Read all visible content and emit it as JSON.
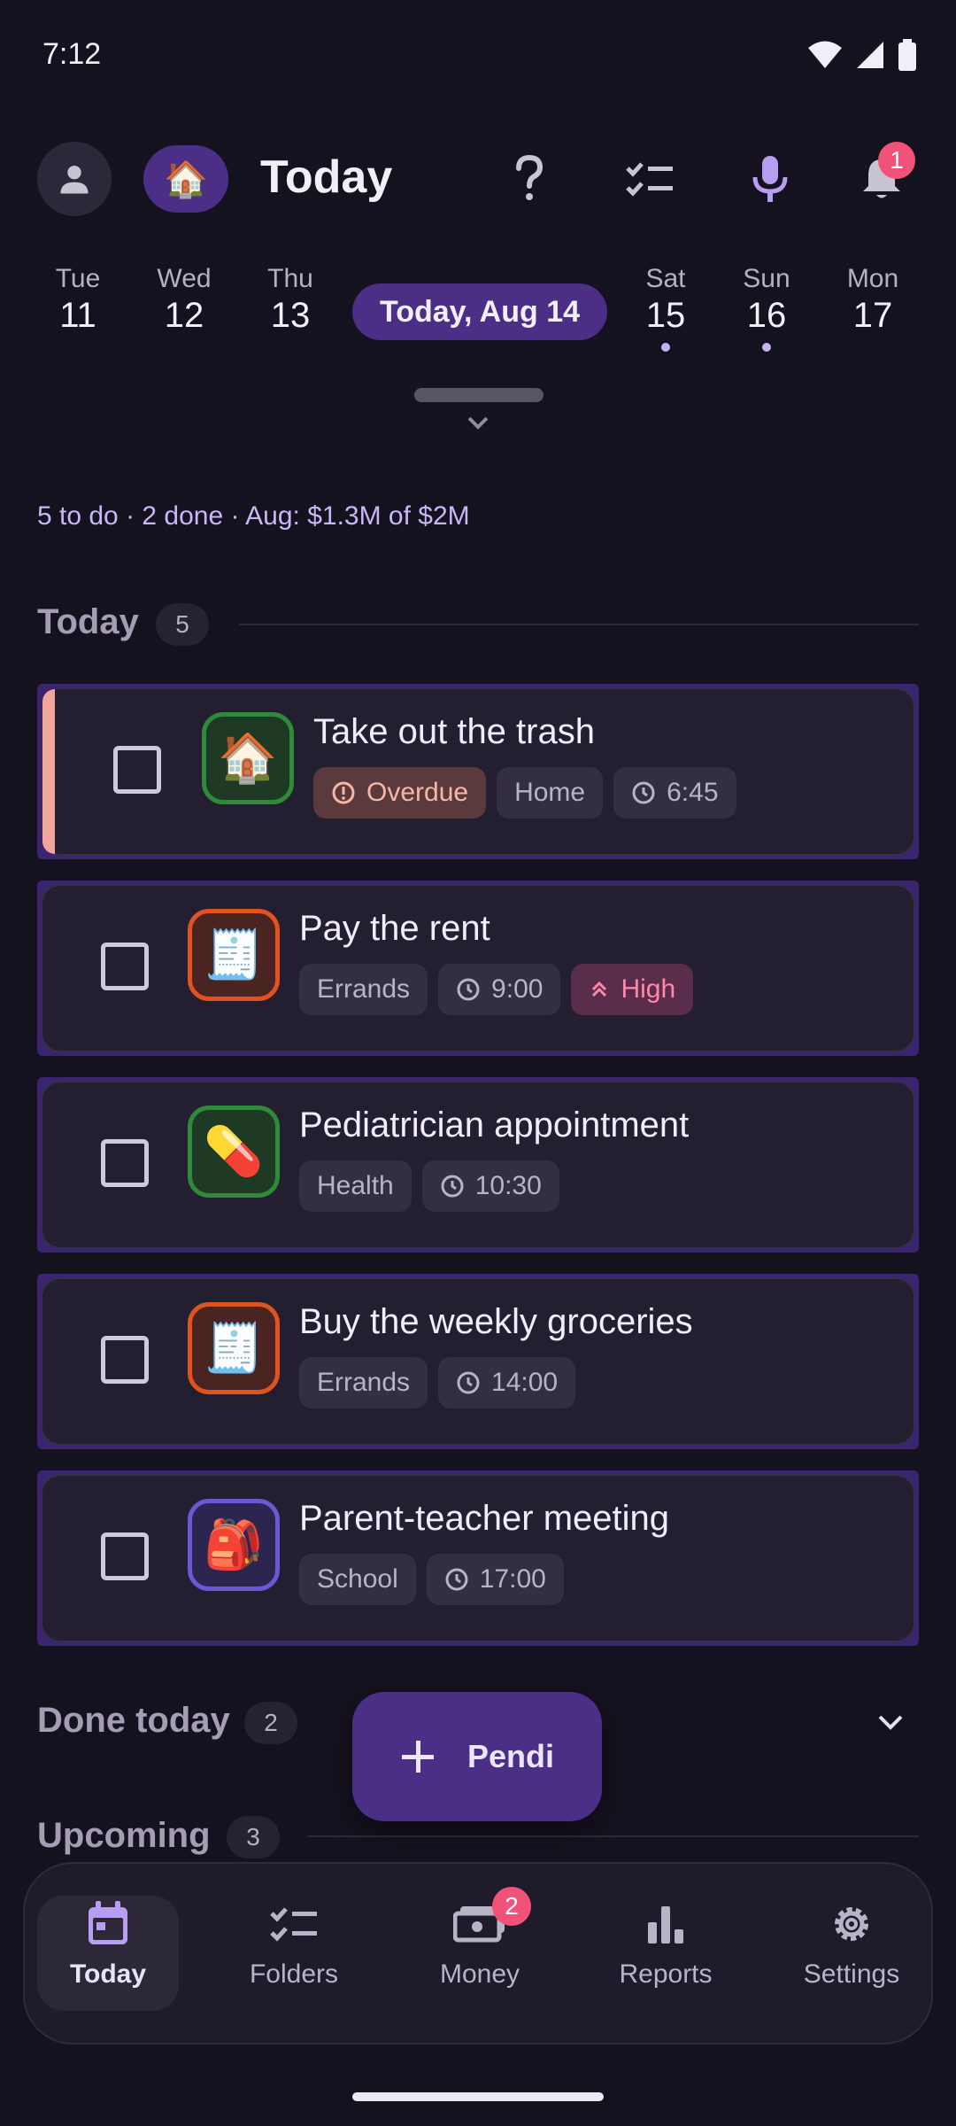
{
  "status_bar": {
    "time": "7:12"
  },
  "header": {
    "title": "Today",
    "home_icon": "house-emoji",
    "notifications_count": "1"
  },
  "date_strip": {
    "days": [
      {
        "dow": "Tue",
        "num": "11",
        "dot": false
      },
      {
        "dow": "Wed",
        "num": "12",
        "dot": false
      },
      {
        "dow": "Thu",
        "num": "13",
        "dot": false
      },
      {
        "dow": "Sat",
        "num": "15",
        "dot": true
      },
      {
        "dow": "Sun",
        "num": "16",
        "dot": true
      },
      {
        "dow": "Mon",
        "num": "17",
        "dot": false
      }
    ],
    "selected_label": "Today, Aug 14"
  },
  "summary": "5 to do · 2 done · Aug: $1.3M of $2M",
  "sections": {
    "today": {
      "title": "Today",
      "count": "5"
    },
    "done": {
      "title": "Done today",
      "count": "2"
    },
    "upcoming": {
      "title": "Upcoming",
      "count": "3"
    }
  },
  "tasks": [
    {
      "title": "Take out the trash",
      "icon": "🏠",
      "icon_color": "#2f8a3a",
      "overdue": true,
      "chips": [
        {
          "text": "Overdue",
          "kind": "overdue",
          "icon": "alert-icon"
        },
        {
          "text": "Home",
          "kind": "tag"
        },
        {
          "text": "6:45",
          "kind": "time"
        }
      ]
    },
    {
      "title": "Pay the rent",
      "icon": "🧾",
      "icon_color": "#e0521f",
      "overdue": false,
      "chips": [
        {
          "text": "Errands",
          "kind": "tag"
        },
        {
          "text": "9:00",
          "kind": "time"
        },
        {
          "text": "High",
          "kind": "high"
        }
      ]
    },
    {
      "title": "Pediatrician appointment",
      "icon": "💊",
      "icon_color": "#2f8a3a",
      "overdue": false,
      "chips": [
        {
          "text": "Health",
          "kind": "tag"
        },
        {
          "text": "10:30",
          "kind": "time"
        }
      ]
    },
    {
      "title": "Buy the weekly groceries",
      "icon": "🧾",
      "icon_color": "#e0521f",
      "overdue": false,
      "chips": [
        {
          "text": "Errands",
          "kind": "tag"
        },
        {
          "text": "14:00",
          "kind": "time"
        }
      ]
    },
    {
      "title": "Parent-teacher meeting",
      "icon": "🎒",
      "icon_color": "#6a58d6",
      "overdue": false,
      "chips": [
        {
          "text": "School",
          "kind": "tag"
        },
        {
          "text": "17:00",
          "kind": "time"
        }
      ]
    }
  ],
  "fab": {
    "label": "Pendi"
  },
  "bottom_nav": {
    "items": [
      {
        "label": "Today",
        "icon": "calendar-icon"
      },
      {
        "label": "Folders",
        "icon": "checklist-icon"
      },
      {
        "label": "Money",
        "icon": "money-icon",
        "badge": "2"
      },
      {
        "label": "Reports",
        "icon": "bar-chart-icon"
      },
      {
        "label": "Settings",
        "icon": "gear-icon"
      }
    ]
  },
  "colors": {
    "background": "#15121f",
    "accent": "#4b2e86",
    "badge": "#f0527a"
  }
}
